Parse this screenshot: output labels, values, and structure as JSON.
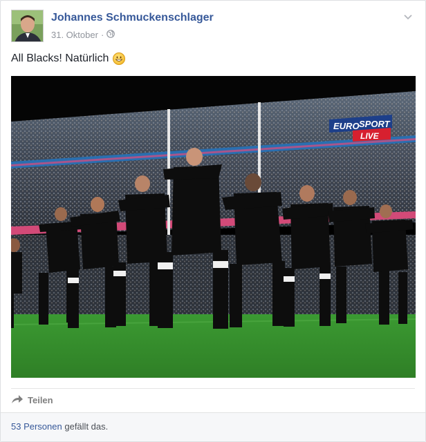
{
  "post": {
    "author": "Johannes Schmuckenschlager",
    "date": "31. Oktober",
    "date_separator": "·",
    "privacy_icon": "globe-icon",
    "text": "All Blacks! Natürlich",
    "emoji": "grinning-face-emoji"
  },
  "media": {
    "overlay_line1": "EURO",
    "overlay_line1b": "SPORT",
    "overlay_line2": "LIVE"
  },
  "actions": {
    "share_label": "Teilen",
    "share_icon": "share-arrow-icon"
  },
  "likes": {
    "count_link": "53 Personen",
    "suffix": "gefällt das."
  },
  "colors": {
    "link": "#365899",
    "meta": "#90949c",
    "footer_bg": "#f6f7f9",
    "pitch": "#3a8f2e"
  }
}
